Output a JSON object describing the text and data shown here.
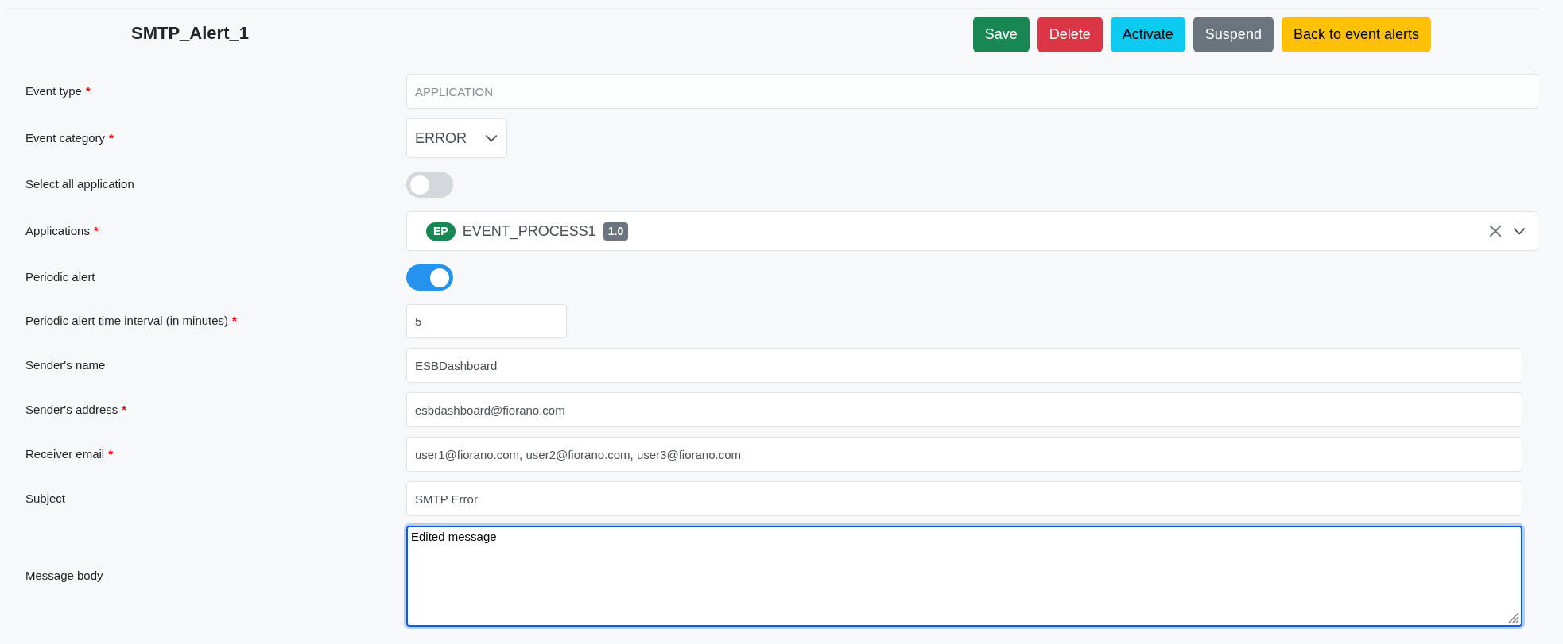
{
  "title": "SMTP_Alert_1",
  "buttons": [
    "Save",
    "Delete",
    "Activate",
    "Suspend",
    "Back to event alerts"
  ],
  "fields": [
    {
      "label": "Event type",
      "required_mark": "*",
      "kind": "text",
      "value": "APPLICATION",
      "disabled": true
    },
    {
      "label": "Event category",
      "required_mark": "*",
      "kind": "select",
      "value": "ERROR"
    },
    {
      "label": "Select all application",
      "kind": "toggle",
      "on": false
    },
    {
      "label": "Applications",
      "required_mark": "*",
      "kind": "multiselect",
      "tags": [
        {
          "badge": "EP",
          "name": "EVENT_PROCESS1",
          "version": "1.0"
        }
      ]
    },
    {
      "label": "Periodic alert",
      "kind": "toggle",
      "on": true
    },
    {
      "label": "Periodic alert time interval (in minutes)",
      "required_mark": "*",
      "kind": "number",
      "value": "5"
    },
    {
      "label": "Sender's name",
      "kind": "text",
      "value": "ESBDashboard",
      "disabled": false
    },
    {
      "label": "Sender's address",
      "required_mark": "*",
      "kind": "text",
      "value": "esbdashboard@fiorano.com",
      "disabled": false
    },
    {
      "label": "Receiver email",
      "required_mark": "*",
      "kind": "text",
      "value": "user1@fiorano.com, user2@fiorano.com, user3@fiorano.com",
      "disabled": false
    },
    {
      "label": "Subject",
      "kind": "text",
      "value": "SMTP Error",
      "disabled": false
    },
    {
      "label": "Message body",
      "kind": "textarea",
      "value": "Edited message",
      "focused": true
    }
  ]
}
